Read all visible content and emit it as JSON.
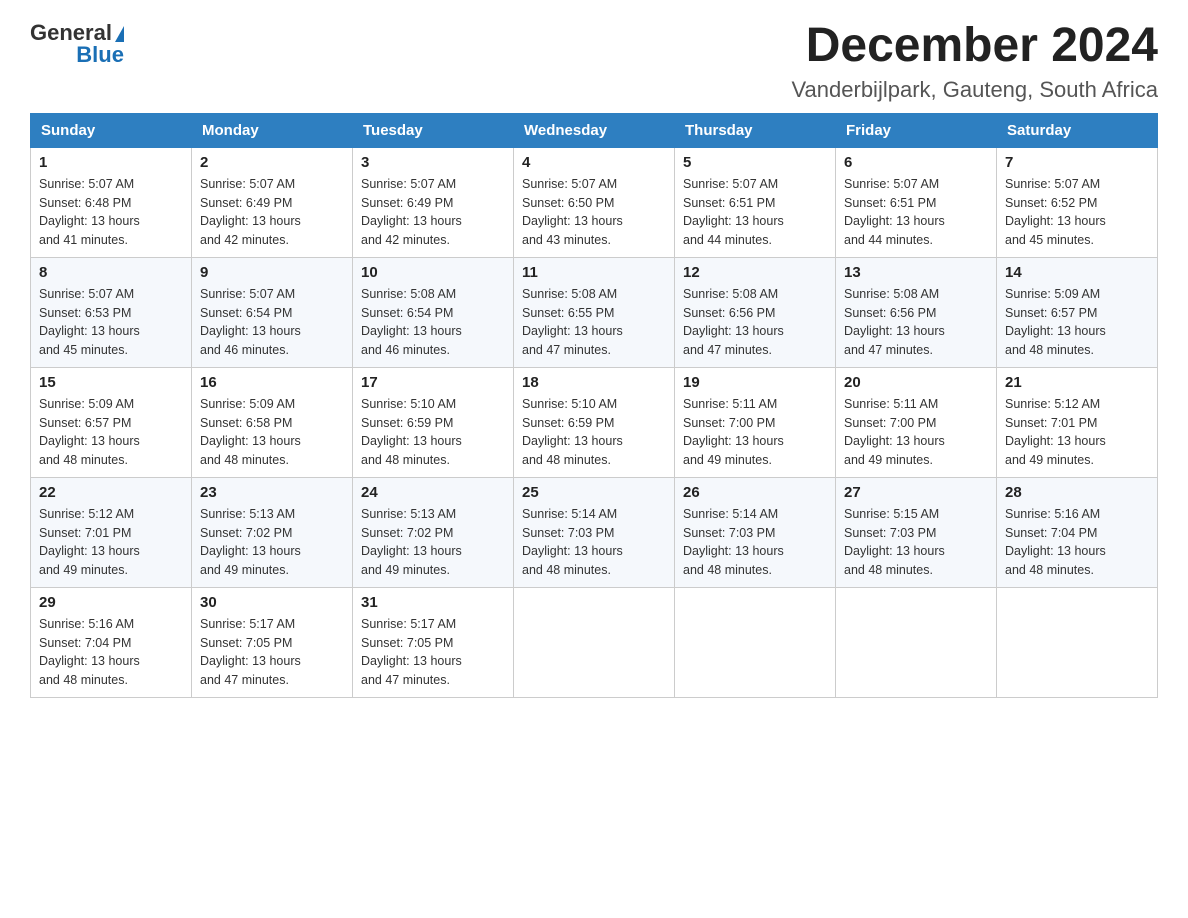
{
  "header": {
    "logo": {
      "general": "General",
      "blue": "Blue"
    },
    "month_title": "December 2024",
    "location": "Vanderbijlpark, Gauteng, South Africa"
  },
  "weekdays": [
    "Sunday",
    "Monday",
    "Tuesday",
    "Wednesday",
    "Thursday",
    "Friday",
    "Saturday"
  ],
  "weeks": [
    [
      {
        "day": "1",
        "sunrise": "5:07 AM",
        "sunset": "6:48 PM",
        "daylight": "13 hours and 41 minutes."
      },
      {
        "day": "2",
        "sunrise": "5:07 AM",
        "sunset": "6:49 PM",
        "daylight": "13 hours and 42 minutes."
      },
      {
        "day": "3",
        "sunrise": "5:07 AM",
        "sunset": "6:49 PM",
        "daylight": "13 hours and 42 minutes."
      },
      {
        "day": "4",
        "sunrise": "5:07 AM",
        "sunset": "6:50 PM",
        "daylight": "13 hours and 43 minutes."
      },
      {
        "day": "5",
        "sunrise": "5:07 AM",
        "sunset": "6:51 PM",
        "daylight": "13 hours and 44 minutes."
      },
      {
        "day": "6",
        "sunrise": "5:07 AM",
        "sunset": "6:51 PM",
        "daylight": "13 hours and 44 minutes."
      },
      {
        "day": "7",
        "sunrise": "5:07 AM",
        "sunset": "6:52 PM",
        "daylight": "13 hours and 45 minutes."
      }
    ],
    [
      {
        "day": "8",
        "sunrise": "5:07 AM",
        "sunset": "6:53 PM",
        "daylight": "13 hours and 45 minutes."
      },
      {
        "day": "9",
        "sunrise": "5:07 AM",
        "sunset": "6:54 PM",
        "daylight": "13 hours and 46 minutes."
      },
      {
        "day": "10",
        "sunrise": "5:08 AM",
        "sunset": "6:54 PM",
        "daylight": "13 hours and 46 minutes."
      },
      {
        "day": "11",
        "sunrise": "5:08 AM",
        "sunset": "6:55 PM",
        "daylight": "13 hours and 47 minutes."
      },
      {
        "day": "12",
        "sunrise": "5:08 AM",
        "sunset": "6:56 PM",
        "daylight": "13 hours and 47 minutes."
      },
      {
        "day": "13",
        "sunrise": "5:08 AM",
        "sunset": "6:56 PM",
        "daylight": "13 hours and 47 minutes."
      },
      {
        "day": "14",
        "sunrise": "5:09 AM",
        "sunset": "6:57 PM",
        "daylight": "13 hours and 48 minutes."
      }
    ],
    [
      {
        "day": "15",
        "sunrise": "5:09 AM",
        "sunset": "6:57 PM",
        "daylight": "13 hours and 48 minutes."
      },
      {
        "day": "16",
        "sunrise": "5:09 AM",
        "sunset": "6:58 PM",
        "daylight": "13 hours and 48 minutes."
      },
      {
        "day": "17",
        "sunrise": "5:10 AM",
        "sunset": "6:59 PM",
        "daylight": "13 hours and 48 minutes."
      },
      {
        "day": "18",
        "sunrise": "5:10 AM",
        "sunset": "6:59 PM",
        "daylight": "13 hours and 48 minutes."
      },
      {
        "day": "19",
        "sunrise": "5:11 AM",
        "sunset": "7:00 PM",
        "daylight": "13 hours and 49 minutes."
      },
      {
        "day": "20",
        "sunrise": "5:11 AM",
        "sunset": "7:00 PM",
        "daylight": "13 hours and 49 minutes."
      },
      {
        "day": "21",
        "sunrise": "5:12 AM",
        "sunset": "7:01 PM",
        "daylight": "13 hours and 49 minutes."
      }
    ],
    [
      {
        "day": "22",
        "sunrise": "5:12 AM",
        "sunset": "7:01 PM",
        "daylight": "13 hours and 49 minutes."
      },
      {
        "day": "23",
        "sunrise": "5:13 AM",
        "sunset": "7:02 PM",
        "daylight": "13 hours and 49 minutes."
      },
      {
        "day": "24",
        "sunrise": "5:13 AM",
        "sunset": "7:02 PM",
        "daylight": "13 hours and 49 minutes."
      },
      {
        "day": "25",
        "sunrise": "5:14 AM",
        "sunset": "7:03 PM",
        "daylight": "13 hours and 48 minutes."
      },
      {
        "day": "26",
        "sunrise": "5:14 AM",
        "sunset": "7:03 PM",
        "daylight": "13 hours and 48 minutes."
      },
      {
        "day": "27",
        "sunrise": "5:15 AM",
        "sunset": "7:03 PM",
        "daylight": "13 hours and 48 minutes."
      },
      {
        "day": "28",
        "sunrise": "5:16 AM",
        "sunset": "7:04 PM",
        "daylight": "13 hours and 48 minutes."
      }
    ],
    [
      {
        "day": "29",
        "sunrise": "5:16 AM",
        "sunset": "7:04 PM",
        "daylight": "13 hours and 48 minutes."
      },
      {
        "day": "30",
        "sunrise": "5:17 AM",
        "sunset": "7:05 PM",
        "daylight": "13 hours and 47 minutes."
      },
      {
        "day": "31",
        "sunrise": "5:17 AM",
        "sunset": "7:05 PM",
        "daylight": "13 hours and 47 minutes."
      },
      null,
      null,
      null,
      null
    ]
  ],
  "labels": {
    "sunrise": "Sunrise:",
    "sunset": "Sunset:",
    "daylight": "Daylight:"
  }
}
